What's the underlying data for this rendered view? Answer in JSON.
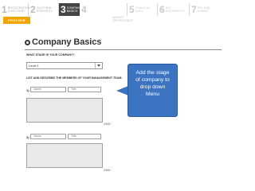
{
  "steps": [
    {
      "num": "1",
      "line1": "Registration",
      "line2": "& Account"
    },
    {
      "num": "2",
      "line1": "Cultural",
      "line2": "Strategy"
    },
    {
      "num": "3",
      "line1": "Company",
      "line2": "Basics"
    },
    {
      "num": "4",
      "line1": "",
      "line2": ""
    },
    {
      "num": "5",
      "line1": "Financial",
      "line2": "Data"
    },
    {
      "num": "6",
      "line1": "Key",
      "line2": "Documents"
    },
    {
      "num": "7",
      "line1": "Pay and",
      "line2": "Submit"
    }
  ],
  "step4_sub": {
    "line1": "Market",
    "line2": "Opportunity"
  },
  "preview_label": "PREVIEW",
  "page_title": "Company Basics",
  "stage_question": "WHAT STAGE IS YOUR COMPANY?",
  "stage_select": {
    "value": "Level 1"
  },
  "team_question": "LIST AND DESCRIBE THE MEMBERS OF YOUR MANAGEMENT TEAM:",
  "members": [
    {
      "num": "1)",
      "name_placeholder": "Name",
      "title_placeholder": "Title",
      "counter": "0/500"
    },
    {
      "num": "2)",
      "name_placeholder": "Name",
      "title_placeholder": "Title",
      "counter": "0/500"
    }
  ],
  "callout": {
    "line1": "Add the stage",
    "line2": "of company to",
    "line3": "drop down",
    "line4": "Menu"
  },
  "colors": {
    "active_step": "#444444",
    "preview": "#f0a500",
    "callout": "#3d74c1",
    "textarea": "#e9e9e9"
  }
}
